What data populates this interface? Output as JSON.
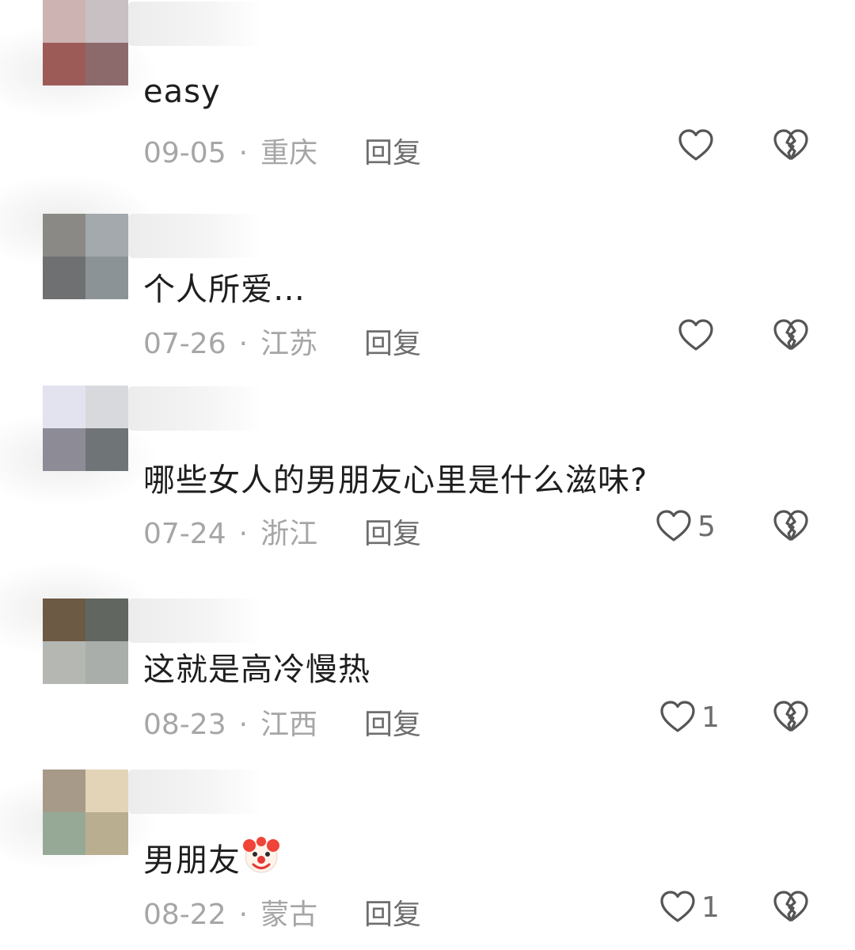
{
  "comments": [
    {
      "text": "easy",
      "date": "09-05",
      "separator": "·",
      "location": "重庆",
      "reply_label": "回复",
      "likes": "",
      "avatar_colors": [
        "#cdb3b1",
        "#c9c0c3",
        "#9d5b58",
        "#8c6a6c"
      ],
      "like_icon": "heart-outline-icon",
      "dislike_icon": "broken-heart-icon"
    },
    {
      "text": "个人所爱…",
      "date": "07-26",
      "separator": "·",
      "location": "江苏",
      "reply_label": "回复",
      "likes": "",
      "avatar_colors": [
        "#8a8985",
        "#a3a9ac",
        "#6f7071",
        "#8c9396"
      ],
      "like_icon": "heart-outline-icon",
      "dislike_icon": "broken-heart-icon"
    },
    {
      "text": "哪些女人的男朋友心里是什么滋味?",
      "date": "07-24",
      "separator": "·",
      "location": "浙江",
      "reply_label": "回复",
      "likes": "5",
      "avatar_colors": [
        "#e2e3ef",
        "#d8d9dd",
        "#8d8c96",
        "#6f7477"
      ],
      "like_icon": "heart-outline-icon",
      "dislike_icon": "broken-heart-icon"
    },
    {
      "text": "这就是高冷慢热",
      "date": "08-23",
      "separator": "·",
      "location": "江西",
      "reply_label": "回复",
      "likes": "1",
      "avatar_colors": [
        "#6c5a45",
        "#616760",
        "#b5b7b2",
        "#a9aeaa"
      ],
      "like_icon": "heart-outline-icon",
      "dislike_icon": "broken-heart-icon"
    },
    {
      "text": "男朋友",
      "emoji": "clown-face-emoji",
      "date": "08-22",
      "separator": "·",
      "location": "蒙古",
      "reply_label": "回复",
      "likes": "1",
      "avatar_colors": [
        "#a89a88",
        "#e3d4b8",
        "#96a997",
        "#b9ae8f"
      ],
      "like_icon": "heart-outline-icon",
      "dislike_icon": "broken-heart-icon"
    }
  ]
}
